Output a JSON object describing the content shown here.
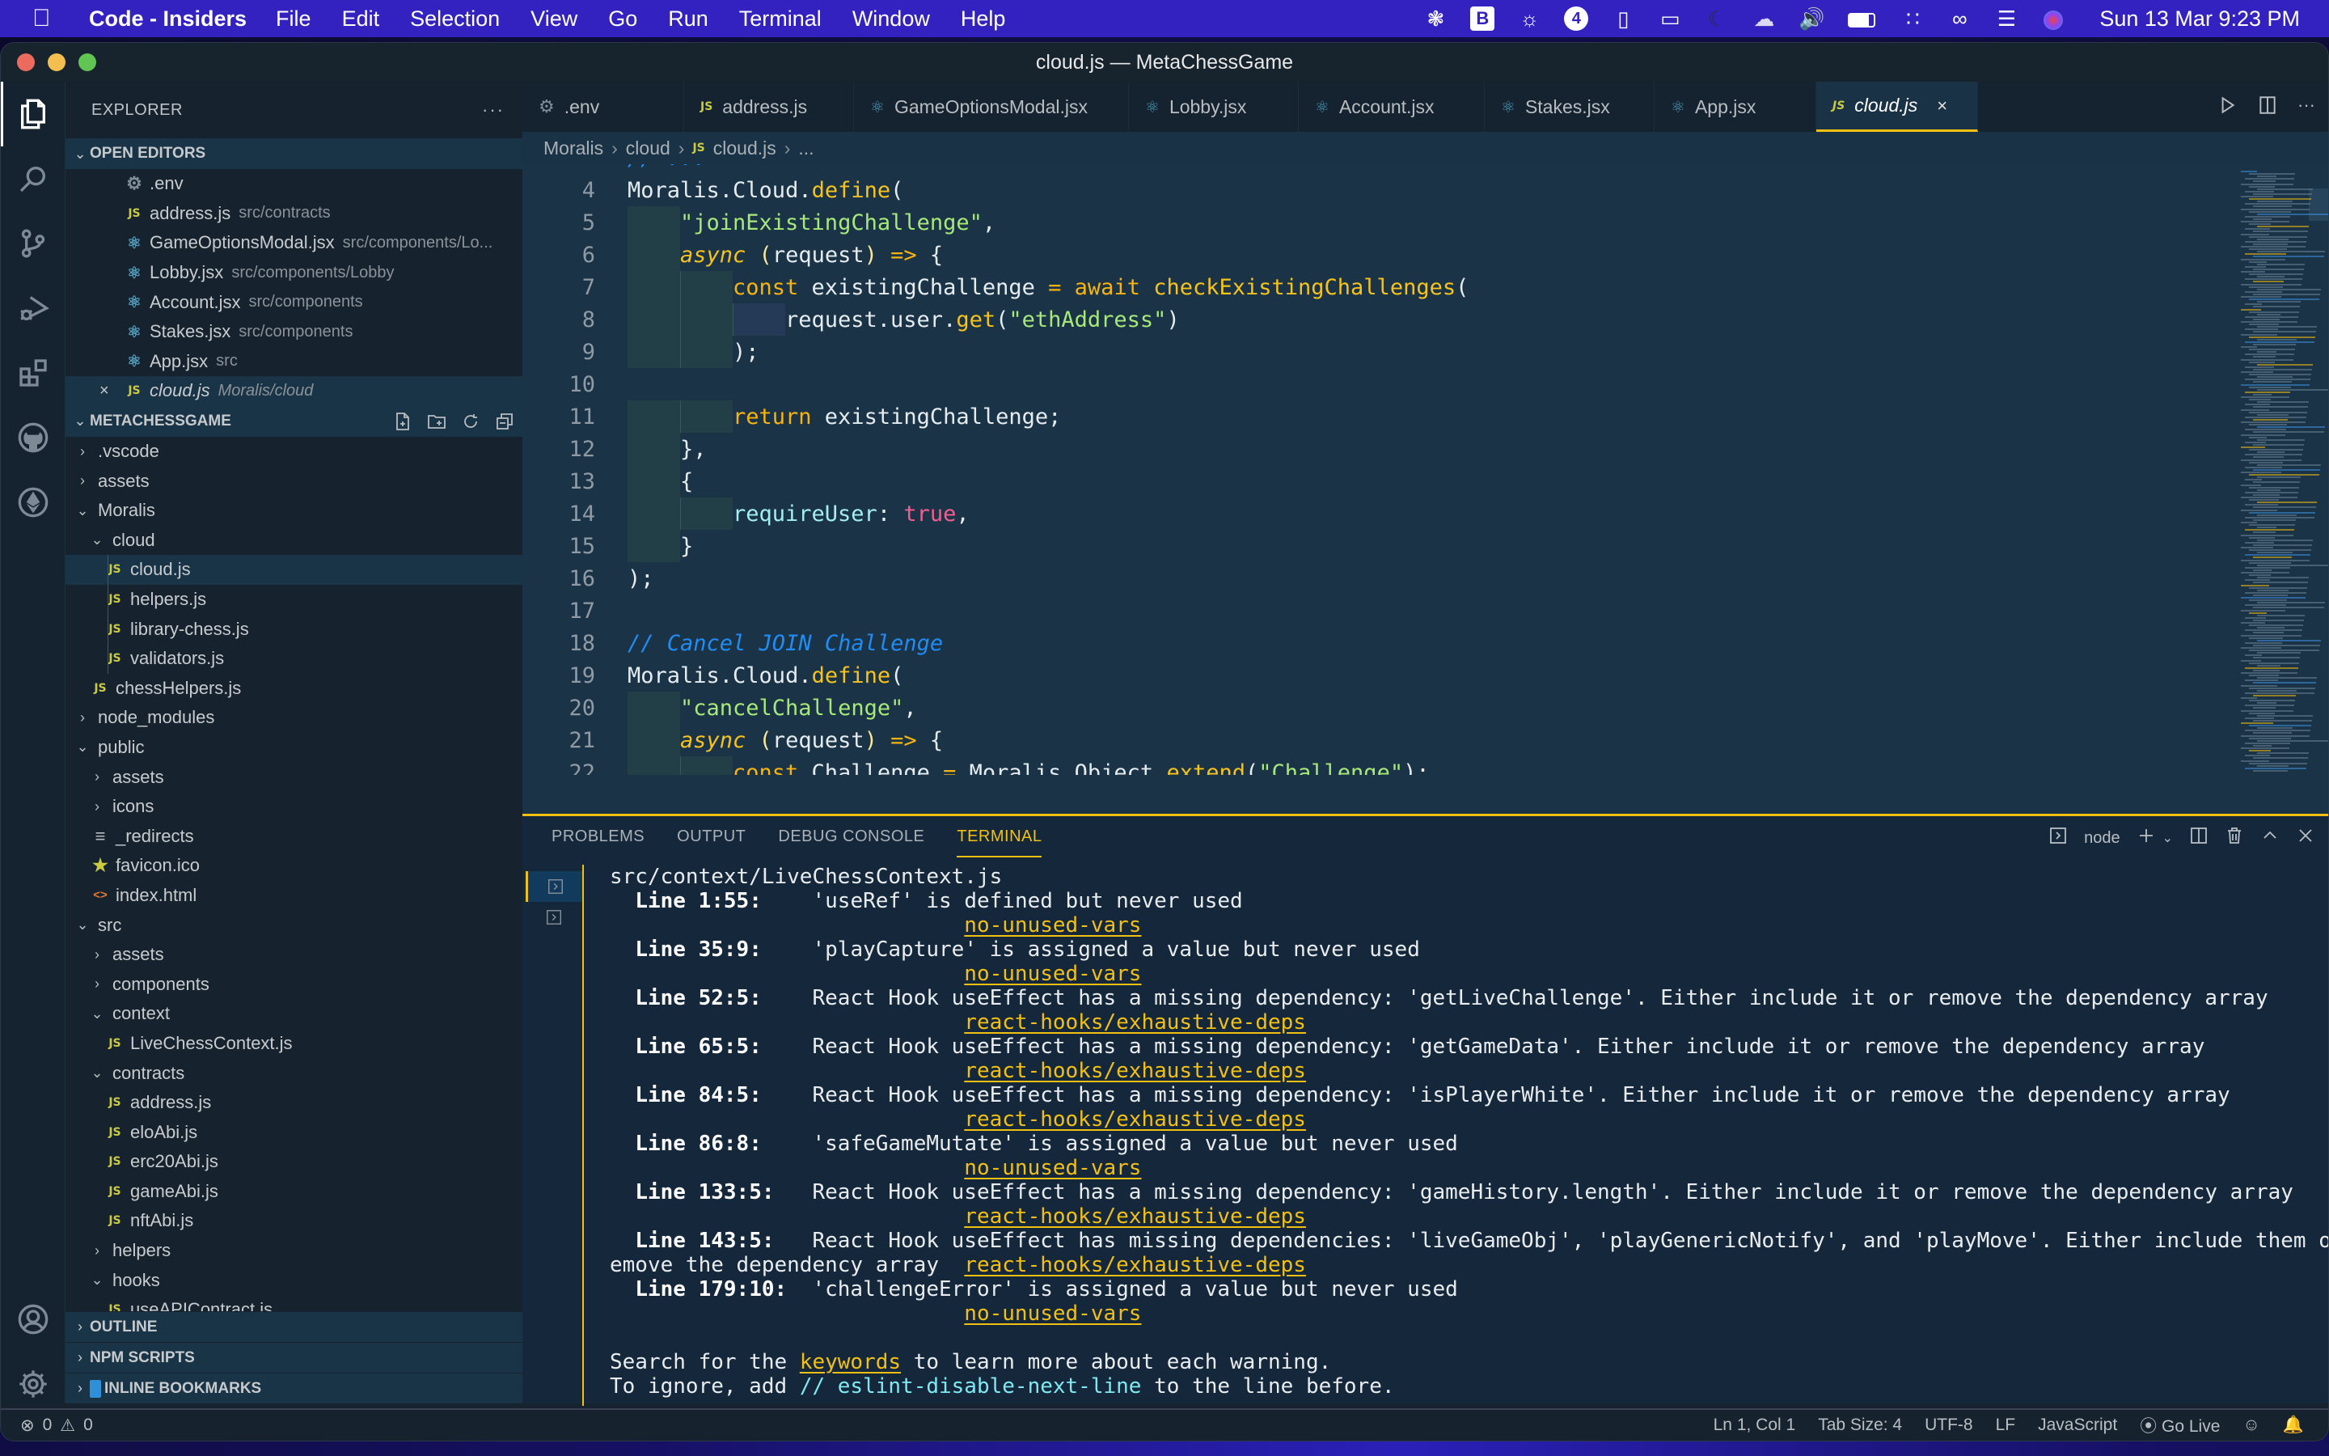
{
  "menubar": {
    "app_name": "Code - Insiders",
    "items": [
      "File",
      "Edit",
      "Selection",
      "View",
      "Go",
      "Run",
      "Terminal",
      "Window",
      "Help"
    ],
    "tray_icons": [
      "sunburst-icon",
      "bitwarden-icon",
      "brightness-icon",
      "app-a-icon",
      "memory-chip-icon",
      "display-icon",
      "moon-icon",
      "cloud-icon",
      "volume-icon",
      "battery-icon",
      "bluetooth-icon",
      "link-icon",
      "control-center-icon",
      "siri-icon"
    ],
    "clock": "Sun 13 Mar  9:23 PM"
  },
  "window": {
    "title": "cloud.js — MetaChessGame"
  },
  "activity_bar": [
    "explorer-icon",
    "search-icon",
    "source-control-icon",
    "run-debug-icon",
    "extensions-icon",
    "github-icon",
    "ethereum-icon",
    "account-icon",
    "settings-gear-icon"
  ],
  "sidebar": {
    "title": "EXPLORER",
    "open_editors": {
      "label": "OPEN EDITORS",
      "items": [
        {
          "icon": "gear",
          "name": ".env",
          "desc": ""
        },
        {
          "icon": "js",
          "name": "address.js",
          "desc": "src/contracts"
        },
        {
          "icon": "react",
          "name": "GameOptionsModal.jsx",
          "desc": "src/components/Lo..."
        },
        {
          "icon": "react",
          "name": "Lobby.jsx",
          "desc": "src/components/Lobby"
        },
        {
          "icon": "react",
          "name": "Account.jsx",
          "desc": "src/components"
        },
        {
          "icon": "react",
          "name": "Stakes.jsx",
          "desc": "src/components"
        },
        {
          "icon": "react",
          "name": "App.jsx",
          "desc": "src"
        },
        {
          "icon": "js",
          "name": "cloud.js",
          "desc": "Moralis/cloud",
          "active": true
        }
      ]
    },
    "project": {
      "label": "METACHESSGAME",
      "tree": [
        {
          "depth": 0,
          "type": "folder",
          "open": false,
          "name": ".vscode"
        },
        {
          "depth": 0,
          "type": "folder",
          "open": false,
          "name": "assets"
        },
        {
          "depth": 0,
          "type": "folder",
          "open": true,
          "name": "Moralis"
        },
        {
          "depth": 1,
          "type": "folder",
          "open": true,
          "name": "cloud"
        },
        {
          "depth": 2,
          "type": "js",
          "name": "cloud.js",
          "selected": true
        },
        {
          "depth": 2,
          "type": "js",
          "name": "helpers.js"
        },
        {
          "depth": 2,
          "type": "js",
          "name": "library-chess.js"
        },
        {
          "depth": 2,
          "type": "js",
          "name": "validators.js"
        },
        {
          "depth": 1,
          "type": "js",
          "name": "chessHelpers.js"
        },
        {
          "depth": 0,
          "type": "folder",
          "open": false,
          "name": "node_modules"
        },
        {
          "depth": 0,
          "type": "folder",
          "open": true,
          "name": "public"
        },
        {
          "depth": 1,
          "type": "folder",
          "open": false,
          "name": "assets"
        },
        {
          "depth": 1,
          "type": "folder",
          "open": false,
          "name": "icons"
        },
        {
          "depth": 1,
          "type": "text",
          "name": "_redirects"
        },
        {
          "depth": 1,
          "type": "star",
          "name": "favicon.ico"
        },
        {
          "depth": 1,
          "type": "html",
          "name": "index.html"
        },
        {
          "depth": 0,
          "type": "folder",
          "open": true,
          "name": "src"
        },
        {
          "depth": 1,
          "type": "folder",
          "open": false,
          "name": "assets"
        },
        {
          "depth": 1,
          "type": "folder",
          "open": false,
          "name": "components"
        },
        {
          "depth": 1,
          "type": "folder",
          "open": true,
          "name": "context"
        },
        {
          "depth": 2,
          "type": "js",
          "name": "LiveChessContext.js"
        },
        {
          "depth": 1,
          "type": "folder",
          "open": true,
          "name": "contracts"
        },
        {
          "depth": 2,
          "type": "js",
          "name": "address.js"
        },
        {
          "depth": 2,
          "type": "js",
          "name": "eloAbi.js"
        },
        {
          "depth": 2,
          "type": "js",
          "name": "erc20Abi.js"
        },
        {
          "depth": 2,
          "type": "js",
          "name": "gameAbi.js"
        },
        {
          "depth": 2,
          "type": "js",
          "name": "nftAbi.js"
        },
        {
          "depth": 1,
          "type": "folder",
          "open": false,
          "name": "helpers"
        },
        {
          "depth": 1,
          "type": "folder",
          "open": true,
          "name": "hooks"
        },
        {
          "depth": 2,
          "type": "js",
          "name": "useAPIContract.js"
        }
      ]
    },
    "bottom_sections": [
      "OUTLINE",
      "NPM SCRIPTS",
      "INLINE BOOKMARKS"
    ]
  },
  "tabs": [
    {
      "icon": "gear",
      "label": ".env"
    },
    {
      "icon": "js",
      "label": "address.js"
    },
    {
      "icon": "react",
      "label": "GameOptionsModal.jsx"
    },
    {
      "icon": "react",
      "label": "Lobby.jsx"
    },
    {
      "icon": "react",
      "label": "Account.jsx"
    },
    {
      "icon": "react",
      "label": "Stakes.jsx"
    },
    {
      "icon": "react",
      "label": "App.jsx"
    },
    {
      "icon": "js",
      "label": "cloud.js",
      "active": true
    }
  ],
  "breadcrumb": [
    "Moralis",
    "cloud",
    "cloud.js",
    "..."
  ],
  "code": {
    "lines": [
      {
        "n": "4",
        "indent": 0,
        "tokens": [
          [
            "",
            "Moralis.Cloud."
          ],
          [
            "fn",
            "define"
          ],
          [
            "",
            "("
          ]
        ]
      },
      {
        "n": "5",
        "indent": 1,
        "tokens": [
          [
            "str",
            "\"joinExistingChallenge\""
          ],
          [
            "",
            ","
          ]
        ]
      },
      {
        "n": "6",
        "indent": 1,
        "tokens": [
          [
            "it",
            "async"
          ],
          [
            "",
            " "
          ],
          [
            "par",
            "("
          ],
          [
            "",
            "request"
          ],
          [
            "par",
            ")"
          ],
          [
            "",
            " "
          ],
          [
            "op",
            "=>"
          ],
          [
            "",
            " {"
          ]
        ]
      },
      {
        "n": "7",
        "indent": 2,
        "tokens": [
          [
            "kw",
            "const"
          ],
          [
            "",
            " existingChallenge "
          ],
          [
            "op",
            "="
          ],
          [
            "",
            " "
          ],
          [
            "kw",
            "await"
          ],
          [
            "",
            " "
          ],
          [
            "fn",
            "checkExistingChallenges"
          ],
          [
            "",
            "("
          ]
        ]
      },
      {
        "n": "8",
        "indent": 3,
        "tokens": [
          [
            "",
            "request.user."
          ],
          [
            "fn",
            "get"
          ],
          [
            "",
            "("
          ],
          [
            "str",
            "\"ethAddress\""
          ],
          [
            "",
            ")"
          ]
        ]
      },
      {
        "n": "9",
        "indent": 2,
        "tokens": [
          [
            "",
            ");"
          ]
        ]
      },
      {
        "n": "10",
        "indent": 0,
        "tokens": []
      },
      {
        "n": "11",
        "indent": 2,
        "tokens": [
          [
            "kw",
            "return"
          ],
          [
            "",
            " existingChallenge;"
          ]
        ]
      },
      {
        "n": "12",
        "indent": 1,
        "tokens": [
          [
            "",
            "},"
          ]
        ]
      },
      {
        "n": "13",
        "indent": 1,
        "tokens": [
          [
            "",
            "{"
          ]
        ]
      },
      {
        "n": "14",
        "indent": 2,
        "tokens": [
          [
            "prop",
            "requireUser"
          ],
          [
            "",
            ": "
          ],
          [
            "bool",
            "true"
          ],
          [
            "",
            ","
          ]
        ]
      },
      {
        "n": "15",
        "indent": 1,
        "tokens": [
          [
            "",
            "}"
          ]
        ]
      },
      {
        "n": "16",
        "indent": 0,
        "tokens": [
          [
            "",
            ");"
          ]
        ]
      },
      {
        "n": "17",
        "indent": 0,
        "tokens": []
      },
      {
        "n": "18",
        "indent": 0,
        "tokens": [
          [
            "com",
            "// Cancel JOIN Challenge"
          ]
        ]
      },
      {
        "n": "19",
        "indent": 0,
        "tokens": [
          [
            "",
            "Moralis.Cloud."
          ],
          [
            "fn",
            "define"
          ],
          [
            "",
            "("
          ]
        ]
      },
      {
        "n": "20",
        "indent": 1,
        "tokens": [
          [
            "str",
            "\"cancelChallenge\""
          ],
          [
            "",
            ","
          ]
        ]
      },
      {
        "n": "21",
        "indent": 1,
        "tokens": [
          [
            "it",
            "async"
          ],
          [
            "",
            " "
          ],
          [
            "par",
            "("
          ],
          [
            "",
            "request"
          ],
          [
            "par",
            ")"
          ],
          [
            "",
            " "
          ],
          [
            "op",
            "=>"
          ],
          [
            "",
            " {"
          ]
        ]
      },
      {
        "n": "22",
        "indent": 2,
        "tokens": [
          [
            "kw",
            "const"
          ],
          [
            "",
            " Challenge "
          ],
          [
            "op",
            "="
          ],
          [
            "",
            " Moralis.Object."
          ],
          [
            "fn",
            "extend"
          ],
          [
            "",
            "("
          ],
          [
            "str",
            "\"Challenge\""
          ],
          [
            "",
            ");"
          ]
        ]
      }
    ]
  },
  "panel": {
    "tabs": [
      "PROBLEMS",
      "OUTPUT",
      "DEBUG CONSOLE",
      "TERMINAL"
    ],
    "active_tab": "TERMINAL",
    "shell": "node",
    "terminal_lines": [
      {
        "plain": "src/context/LiveChessContext.js"
      },
      {
        "loc": "Line 1:55:",
        "msg": "'useRef' is defined but never used"
      },
      {
        "rule_only": "no-unused-vars"
      },
      {
        "loc": "Line 35:9:",
        "msg": "'playCapture' is assigned a value but never used"
      },
      {
        "rule_only": "no-unused-vars"
      },
      {
        "loc": "Line 52:5:",
        "msg": "React Hook useEffect has a missing dependency: 'getLiveChallenge'. Either include it or remove the dependency array"
      },
      {
        "rule_only": "react-hooks/exhaustive-deps"
      },
      {
        "loc": "Line 65:5:",
        "msg": "React Hook useEffect has a missing dependency: 'getGameData'. Either include it or remove the dependency array"
      },
      {
        "rule_only": "react-hooks/exhaustive-deps"
      },
      {
        "loc": "Line 84:5:",
        "msg": "React Hook useEffect has a missing dependency: 'isPlayerWhite'. Either include it or remove the dependency array"
      },
      {
        "rule_only": "react-hooks/exhaustive-deps"
      },
      {
        "loc": "Line 86:8:",
        "msg": "'safeGameMutate' is assigned a value but never used"
      },
      {
        "rule_only": "no-unused-vars"
      },
      {
        "loc": "Line 133:5:",
        "msg": "React Hook useEffect has a missing dependency: 'gameHistory.length'. Either include it or remove the dependency array"
      },
      {
        "rule_only": "react-hooks/exhaustive-deps"
      },
      {
        "loc": "Line 143:5:",
        "msg": "React Hook useEffect has missing dependencies: 'liveGameObj', 'playGenericNotify', and 'playMove'. Either include them or r"
      },
      {
        "wrap": "emove the dependency array  ",
        "rule": "react-hooks/exhaustive-deps"
      },
      {
        "loc": "Line 179:10:",
        "msg": "'challengeError' is assigned a value but never used"
      },
      {
        "rule_only": "no-unused-vars"
      },
      {
        "blank": true
      },
      {
        "search": [
          "Search for the ",
          "keywords",
          " to learn more about each warning."
        ]
      },
      {
        "ignore": [
          "To ignore, add ",
          "// eslint-disable-next-line",
          " to the line before."
        ]
      },
      {
        "blank": true
      },
      {
        "cursor": true
      }
    ]
  },
  "statusbar": {
    "errors": "0",
    "warnings": "0",
    "position": "Ln 1, Col 1",
    "tab_size": "Tab Size: 4",
    "encoding": "UTF-8",
    "eol": "LF",
    "language": "JavaScript",
    "go_live": "Go Live"
  },
  "colors": {
    "accent": "#f2c011",
    "menubar": "#3322bf",
    "editor_bg": "#1b3347",
    "panel_bg": "#15273a"
  }
}
